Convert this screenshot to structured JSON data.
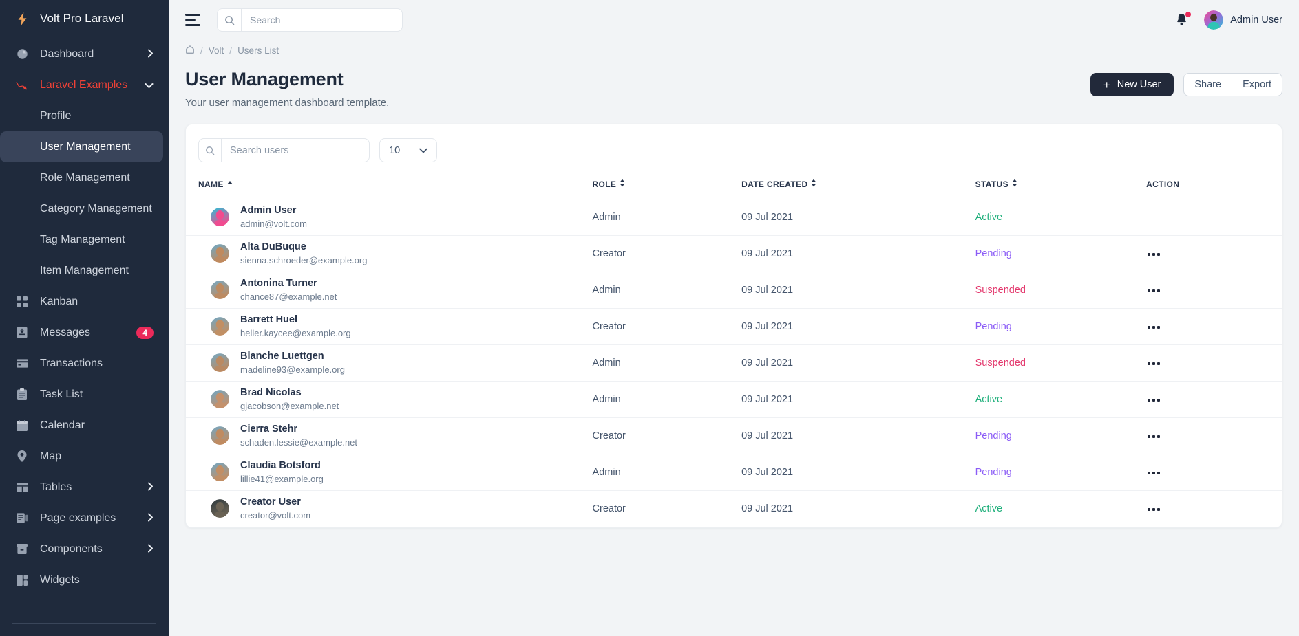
{
  "sidebar": {
    "brand": {
      "label": "Volt Pro Laravel",
      "icon": "lightning-bolt-icon"
    },
    "items": [
      {
        "label": "Dashboard",
        "icon": "pie-chart-icon",
        "chevron": "›",
        "type": "top"
      },
      {
        "label": "Laravel Examples",
        "icon": "laravel-icon",
        "chevron": "⌄",
        "type": "top",
        "accent": true
      },
      {
        "label": "Profile",
        "type": "sub"
      },
      {
        "label": "User Management",
        "type": "sub",
        "active": true
      },
      {
        "label": "Role Management",
        "type": "sub"
      },
      {
        "label": "Category Management",
        "type": "sub"
      },
      {
        "label": "Tag Management",
        "type": "sub"
      },
      {
        "label": "Item Management",
        "type": "sub"
      },
      {
        "label": "Kanban",
        "icon": "grid-icon",
        "type": "top"
      },
      {
        "label": "Messages",
        "icon": "inbox-icon",
        "type": "top",
        "badge": "4"
      },
      {
        "label": "Transactions",
        "icon": "card-icon",
        "type": "top"
      },
      {
        "label": "Task List",
        "icon": "clipboard-icon",
        "type": "top"
      },
      {
        "label": "Calendar",
        "icon": "calendar-icon",
        "type": "top"
      },
      {
        "label": "Map",
        "icon": "map-pin-icon",
        "type": "top"
      },
      {
        "label": "Tables",
        "icon": "table-icon",
        "chevron": "›",
        "type": "top"
      },
      {
        "label": "Page examples",
        "icon": "pages-icon",
        "chevron": "›",
        "type": "top"
      },
      {
        "label": "Components",
        "icon": "box-icon",
        "chevron": "›",
        "type": "top"
      },
      {
        "label": "Widgets",
        "icon": "widgets-icon",
        "type": "top"
      }
    ]
  },
  "topbar": {
    "search_placeholder": "Search",
    "search_value": "",
    "user_name": "Admin User",
    "has_notification": true
  },
  "breadcrumb": {
    "home": "⌂",
    "items": [
      "Volt",
      "Users List"
    ],
    "separator": "/"
  },
  "page": {
    "title": "User Management",
    "subtitle": "Your user management dashboard template.",
    "new_user_label": "New User",
    "new_user_plus": "+",
    "share_label": "Share",
    "export_label": "Export"
  },
  "table_controls": {
    "search_placeholder": "Search users",
    "search_value": "",
    "per_page_value": "10",
    "per_page_caret": "⌄"
  },
  "table": {
    "columns": [
      {
        "label": "NAME",
        "sort": "asc"
      },
      {
        "label": "ROLE",
        "sort": "both"
      },
      {
        "label": "DATE CREATED",
        "sort": "both"
      },
      {
        "label": "STATUS",
        "sort": "both"
      },
      {
        "label": "ACTION",
        "sort": "none"
      }
    ],
    "rows": [
      {
        "name": "Admin User",
        "email": "admin@volt.com",
        "role": "Admin",
        "date": "09 Jul 2021",
        "status": "Active",
        "status_class": "status-active",
        "action": false,
        "av1": "#f24a8f",
        "av2": "#23c4d8"
      },
      {
        "name": "Alta DuBuque",
        "email": "sienna.schroeder@example.org",
        "role": "Creator",
        "date": "09 Jul 2021",
        "status": "Pending",
        "status_class": "status-pending",
        "action": true,
        "av1": "#c08a5e",
        "av2": "#6ba9c8"
      },
      {
        "name": "Antonina Turner",
        "email": "chance87@example.net",
        "role": "Admin",
        "date": "09 Jul 2021",
        "status": "Suspended",
        "status_class": "status-suspended",
        "action": true,
        "av1": "#bd8a60",
        "av2": "#76aac6"
      },
      {
        "name": "Barrett Huel",
        "email": "heller.kaycee@example.org",
        "role": "Creator",
        "date": "09 Jul 2021",
        "status": "Pending",
        "status_class": "status-pending",
        "action": true,
        "av1": "#c28f63",
        "av2": "#6fa8c7"
      },
      {
        "name": "Blanche Luettgen",
        "email": "madeline93@example.org",
        "role": "Admin",
        "date": "09 Jul 2021",
        "status": "Suspended",
        "status_class": "status-suspended",
        "action": true,
        "av1": "#bb8a62",
        "av2": "#74a9c5"
      },
      {
        "name": "Brad Nicolas",
        "email": "gjacobson@example.net",
        "role": "Admin",
        "date": "09 Jul 2021",
        "status": "Active",
        "status_class": "status-active",
        "action": true,
        "av1": "#c5906a",
        "av2": "#6ea6c4"
      },
      {
        "name": "Cierra Stehr",
        "email": "schaden.lessie@example.net",
        "role": "Creator",
        "date": "09 Jul 2021",
        "status": "Pending",
        "status_class": "status-pending",
        "action": true,
        "av1": "#c08b60",
        "av2": "#72a8c6"
      },
      {
        "name": "Claudia Botsford",
        "email": "lillie41@example.org",
        "role": "Admin",
        "date": "09 Jul 2021",
        "status": "Pending",
        "status_class": "status-pending",
        "action": true,
        "av1": "#c28e64",
        "av2": "#70a7c5"
      },
      {
        "name": "Creator User",
        "email": "creator@volt.com",
        "role": "Creator",
        "date": "09 Jul 2021",
        "status": "Active",
        "status_class": "status-active",
        "action": true,
        "av1": "#6b6355",
        "av2": "#2f3a3e"
      }
    ]
  },
  "colors": {
    "sidebar_bg": "#1f2a3c",
    "accent_red": "#ef4136",
    "badge_red": "#eb2a5a",
    "primary_dark": "#22293a",
    "status_active": "#21b07c",
    "status_pending": "#8b5cf6",
    "status_suspended": "#e3376c"
  }
}
